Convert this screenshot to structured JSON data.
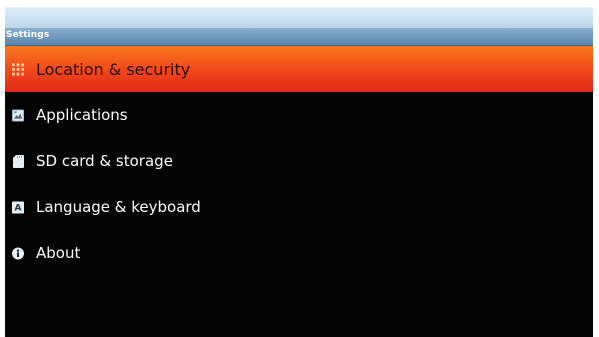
{
  "window": {
    "title": "Settings"
  },
  "settings_list": {
    "items": [
      {
        "label": "Location & security",
        "icon": "location-security-icon",
        "selected": true
      },
      {
        "label": "Applications",
        "icon": "applications-icon",
        "selected": false
      },
      {
        "label": "SD card & storage",
        "icon": "sd-card-icon",
        "selected": false
      },
      {
        "label": "Language & keyboard",
        "icon": "language-keyboard-icon",
        "selected": false
      },
      {
        "label": "About",
        "icon": "about-info-icon",
        "selected": false
      }
    ]
  },
  "colors": {
    "selected_top": "#f97a1d",
    "selected_bottom": "#df2a17",
    "background": "#030303",
    "title_bar": "#6f97bd"
  }
}
